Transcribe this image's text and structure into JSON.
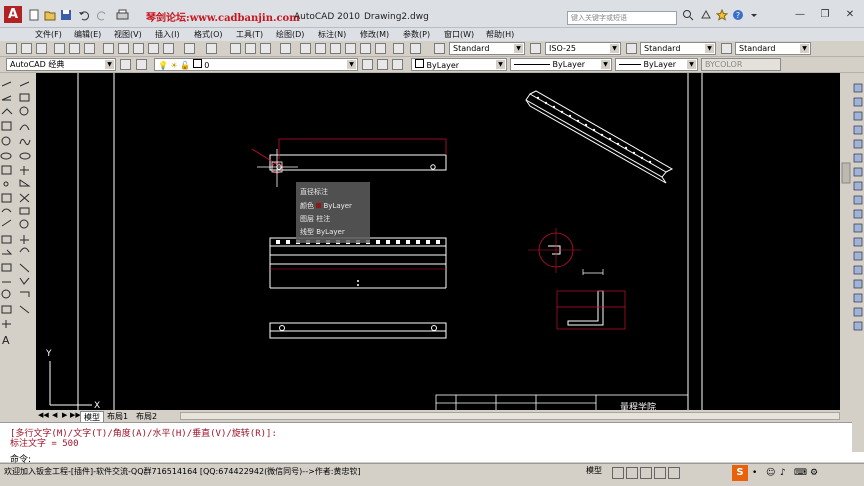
{
  "title_bar": {
    "forum_banner": "琴剑论坛:www.cadbanjin.com",
    "app_title": "AutoCAD 2010",
    "document_title": "Drawing2.dwg",
    "search_placeholder": "键入关键字或短语"
  },
  "menu": {
    "items": [
      "文件(F)",
      "编辑(E)",
      "视图(V)",
      "插入(I)",
      "格式(O)",
      "工具(T)",
      "绘图(D)",
      "标注(N)",
      "修改(M)",
      "参数(P)",
      "窗口(W)",
      "帮助(H)"
    ]
  },
  "styles_toolbar": {
    "text_style": "Standard",
    "dim_style": "ISO-25",
    "table_style": "Standard",
    "multileader_style": "Standard"
  },
  "layers_toolbar": {
    "workspace": "AutoCAD 经典",
    "layer": "0",
    "color": "ByLayer",
    "linetype": "ByLayer",
    "lineweight": "ByLayer",
    "plotstyle": "BYCOLOR"
  },
  "tooltip": {
    "title": "直径标注",
    "rows": [
      {
        "label": "颜色",
        "value": "ByLayer"
      },
      {
        "label": "图层",
        "value": "柱注"
      },
      {
        "label": "线型",
        "value": "ByLayer"
      }
    ]
  },
  "canvas": {
    "title_block_text": "量程学院",
    "ucs_x": "X",
    "ucs_y": "Y"
  },
  "tabs": [
    "模型",
    "布局1",
    "布局2"
  ],
  "command": {
    "history": [
      "[多行文字(M)/文字(T)/角度(A)/水平(H)/垂直(V)/旋转(R)]:",
      "标注文字 = 500"
    ],
    "prompt": "命令:"
  },
  "status": {
    "text": "欢迎加入钣金工程-[插件]-软件交流-QQ群716514164 [QQ:674422942(微信同号)-->作者:黄忠钦]",
    "model_label": "模型"
  },
  "colors": {
    "canvas_bg": "#000000",
    "drawing_white": "#ffffff",
    "dimension_red": "#c8102e",
    "command_text": "#a0142b"
  }
}
